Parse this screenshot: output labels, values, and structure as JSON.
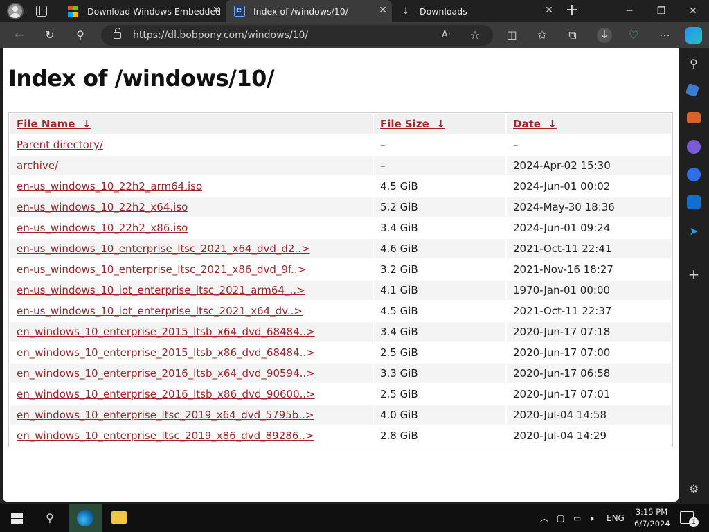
{
  "tabs": [
    {
      "title": "Download Windows Embedded I"
    },
    {
      "title": "Index of /windows/10/"
    },
    {
      "title": "Downloads"
    }
  ],
  "address": {
    "url": "https://dl.bobpony.com/windows/10/"
  },
  "page": {
    "heading": "Index of /windows/10/"
  },
  "table": {
    "headers": {
      "name": "File Name",
      "size": "File Size",
      "date": "Date",
      "sort_arrow": "↓"
    },
    "rows": [
      {
        "name": "Parent directory/",
        "size": "–",
        "date": "–"
      },
      {
        "name": "archive/",
        "size": "–",
        "date": "2024-Apr-02 15:30"
      },
      {
        "name": "en-us_windows_10_22h2_arm64.iso",
        "size": "4.5 GiB",
        "date": "2024-Jun-01 00:02"
      },
      {
        "name": "en-us_windows_10_22h2_x64.iso",
        "size": "5.2 GiB",
        "date": "2024-May-30 18:36"
      },
      {
        "name": "en-us_windows_10_22h2_x86.iso",
        "size": "3.4 GiB",
        "date": "2024-Jun-01 09:24"
      },
      {
        "name": "en-us_windows_10_enterprise_ltsc_2021_x64_dvd_d2..>",
        "size": "4.6 GiB",
        "date": "2021-Oct-11 22:41"
      },
      {
        "name": "en-us_windows_10_enterprise_ltsc_2021_x86_dvd_9f..>",
        "size": "3.2 GiB",
        "date": "2021-Nov-16 18:27"
      },
      {
        "name": "en-us_windows_10_iot_enterprise_ltsc_2021_arm64_..>",
        "size": "4.1 GiB",
        "date": "1970-Jan-01 00:00"
      },
      {
        "name": "en-us_windows_10_iot_enterprise_ltsc_2021_x64_dv..>",
        "size": "4.5 GiB",
        "date": "2021-Oct-11 22:37"
      },
      {
        "name": "en_windows_10_enterprise_2015_ltsb_x64_dvd_68484..>",
        "size": "3.4 GiB",
        "date": "2020-Jun-17 07:18"
      },
      {
        "name": "en_windows_10_enterprise_2015_ltsb_x86_dvd_68484..>",
        "size": "2.5 GiB",
        "date": "2020-Jun-17 07:00"
      },
      {
        "name": "en_windows_10_enterprise_2016_ltsb_x64_dvd_90594..>",
        "size": "3.3 GiB",
        "date": "2020-Jun-17 06:58"
      },
      {
        "name": "en_windows_10_enterprise_2016_ltsb_x86_dvd_90600..>",
        "size": "2.5 GiB",
        "date": "2020-Jun-17 07:01"
      },
      {
        "name": "en_windows_10_enterprise_ltsc_2019_x64_dvd_5795b..>",
        "size": "4.0 GiB",
        "date": "2020-Jul-04 14:58"
      },
      {
        "name": "en_windows_10_enterprise_ltsc_2019_x86_dvd_89286..>",
        "size": "2.8 GiB",
        "date": "2020-Jul-04 14:29"
      }
    ]
  },
  "taskbar": {
    "language": "ENG",
    "time": "3:15 PM",
    "date": "6/7/2024",
    "notification_count": "1"
  },
  "colors": {
    "link": "#a0252c",
    "chrome_dark": "#202020",
    "toolbar": "#3b3b3b"
  },
  "icons": [
    "profile-icon",
    "tab-actions-icon",
    "microsoft-logo-icon",
    "page-icon",
    "download-icon",
    "close-icon",
    "new-tab-icon",
    "minimize-icon",
    "restore-icon",
    "back-icon",
    "refresh-icon",
    "search-icon",
    "lock-icon",
    "read-aloud-icon",
    "favorite-star-icon",
    "split-screen-icon",
    "favorites-icon",
    "collections-icon",
    "downloads-icon",
    "browser-essentials-icon",
    "more-icon",
    "copilot-icon"
  ]
}
